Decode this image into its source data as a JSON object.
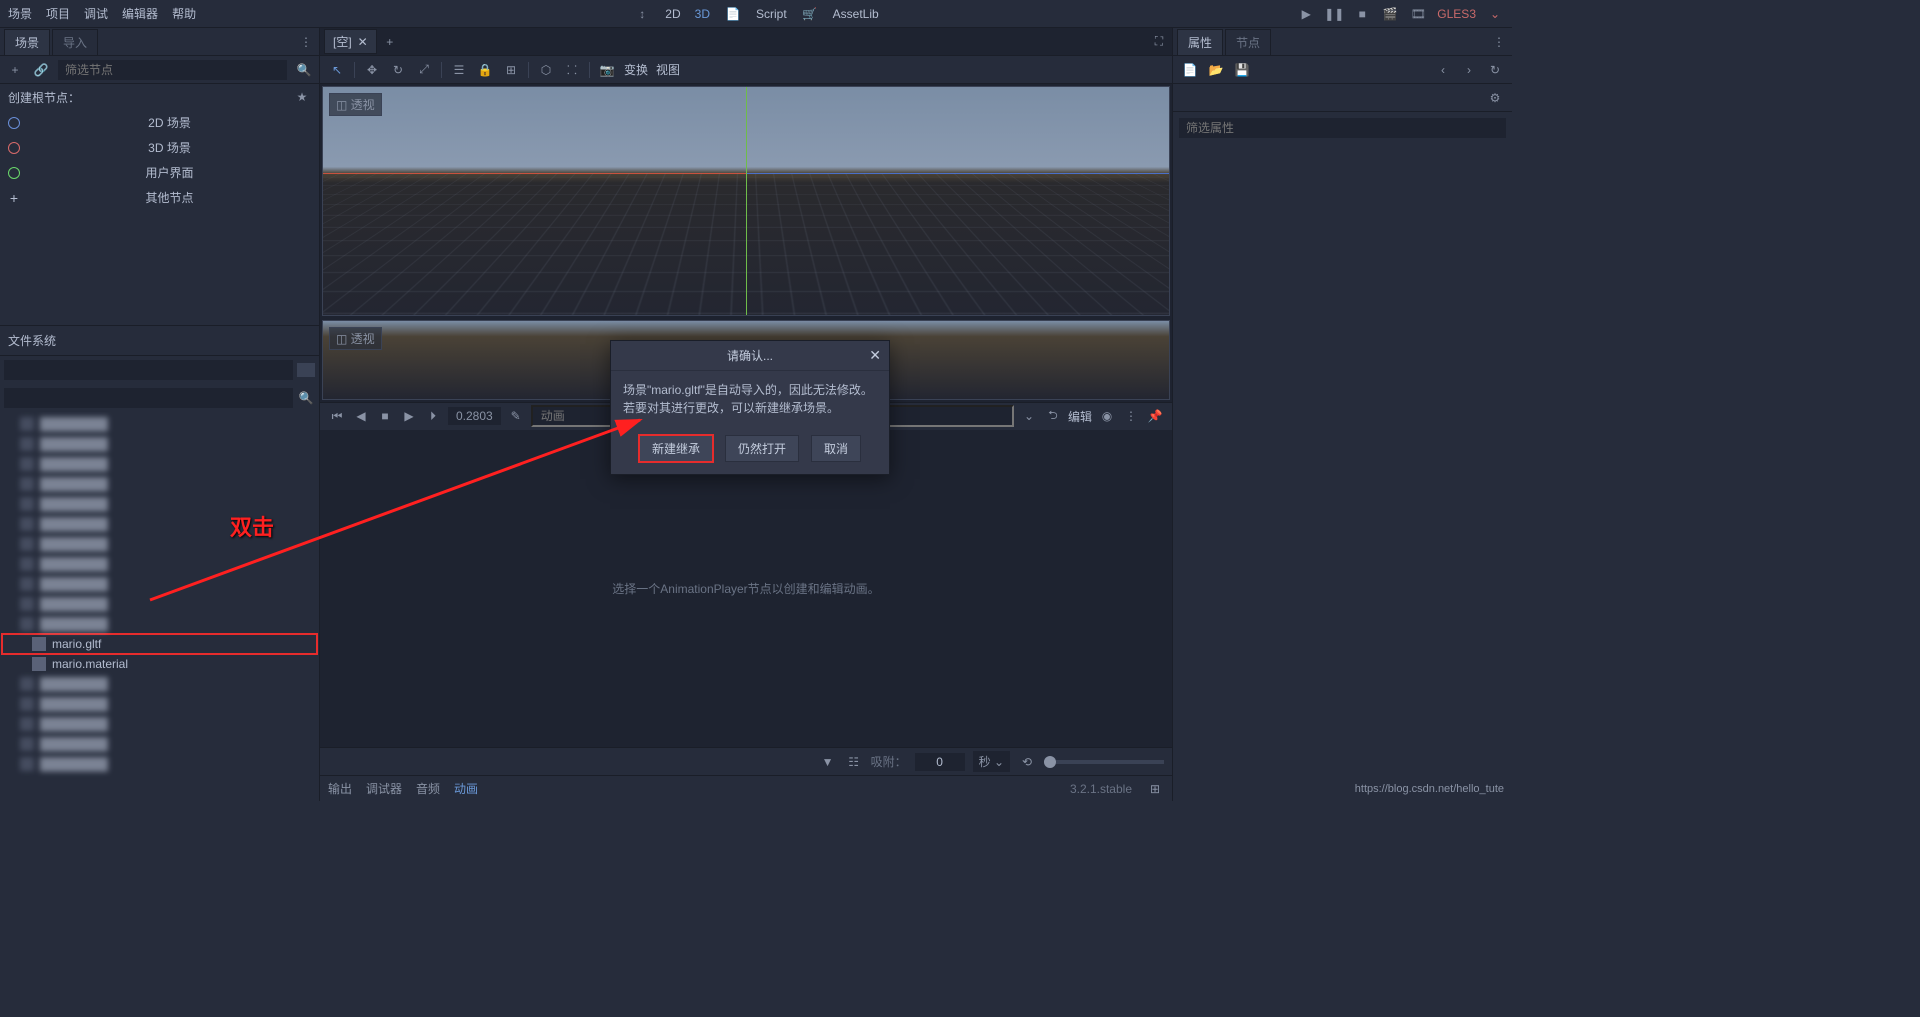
{
  "menubar": {
    "items": [
      "场景",
      "项目",
      "调试",
      "编辑器",
      "帮助"
    ],
    "center": {
      "mode_2d": "2D",
      "mode_3d": "3D",
      "script": "Script",
      "assetlib": "AssetLib"
    },
    "renderer": "GLES3"
  },
  "scene_panel": {
    "tabs": {
      "scene": "场景",
      "import": "导入"
    },
    "filter_placeholder": "筛选节点",
    "create_root_label": "创建根节点：",
    "root_options": {
      "scene_2d": "2D 场景",
      "scene_3d": "3D 场景",
      "ui": "用户界面",
      "other": "其他节点"
    }
  },
  "filesystem": {
    "header": "文件系统",
    "items": [
      {
        "name": "",
        "blurred": true
      },
      {
        "name": "",
        "blurred": true
      },
      {
        "name": "",
        "blurred": true
      },
      {
        "name": "",
        "blurred": true
      },
      {
        "name": "",
        "blurred": true
      },
      {
        "name": "",
        "blurred": true
      },
      {
        "name": "",
        "blurred": true
      },
      {
        "name": "",
        "blurred": true
      },
      {
        "name": "",
        "blurred": true
      },
      {
        "name": "",
        "blurred": true
      },
      {
        "name": "",
        "blurred": true
      },
      {
        "name": "mario.gltf",
        "blurred": false,
        "highlighted": true
      },
      {
        "name": "mario.material",
        "blurred": false
      },
      {
        "name": "",
        "blurred": true
      },
      {
        "name": "",
        "blurred": true
      },
      {
        "name": "",
        "blurred": true
      },
      {
        "name": "",
        "blurred": true
      },
      {
        "name": "",
        "blurred": true
      }
    ]
  },
  "center": {
    "scene_tab": "[空]",
    "viewport_badge": "透视",
    "viewport2_badge": "透视",
    "toolbar": {
      "transform": "变换",
      "view": "视图"
    },
    "anim": {
      "time": "0.2803",
      "track_placeholder": "动画",
      "edit": "编辑",
      "empty_hint": "选择一个AnimationPlayer节点以创建和编辑动画。",
      "snap_label": "吸附：",
      "snap_value": "0",
      "snap_unit": "秒"
    },
    "bottom_tabs": {
      "output": "输出",
      "debugger": "调试器",
      "audio": "音频",
      "animation": "动画"
    },
    "version": "3.2.1.stable"
  },
  "inspector": {
    "tabs": {
      "properties": "属性",
      "node": "节点"
    },
    "filter_placeholder": "筛选属性"
  },
  "dialog": {
    "title": "请确认...",
    "line1": "场景\"mario.gltf\"是自动导入的，因此无法修改。",
    "line2": "若要对其进行更改，可以新建继承场景。",
    "btn_inherit": "新建继承",
    "btn_open": "仍然打开",
    "btn_cancel": "取消"
  },
  "annotation": {
    "text": "双击"
  },
  "watermark": "https://blog.csdn.net/hello_tute"
}
